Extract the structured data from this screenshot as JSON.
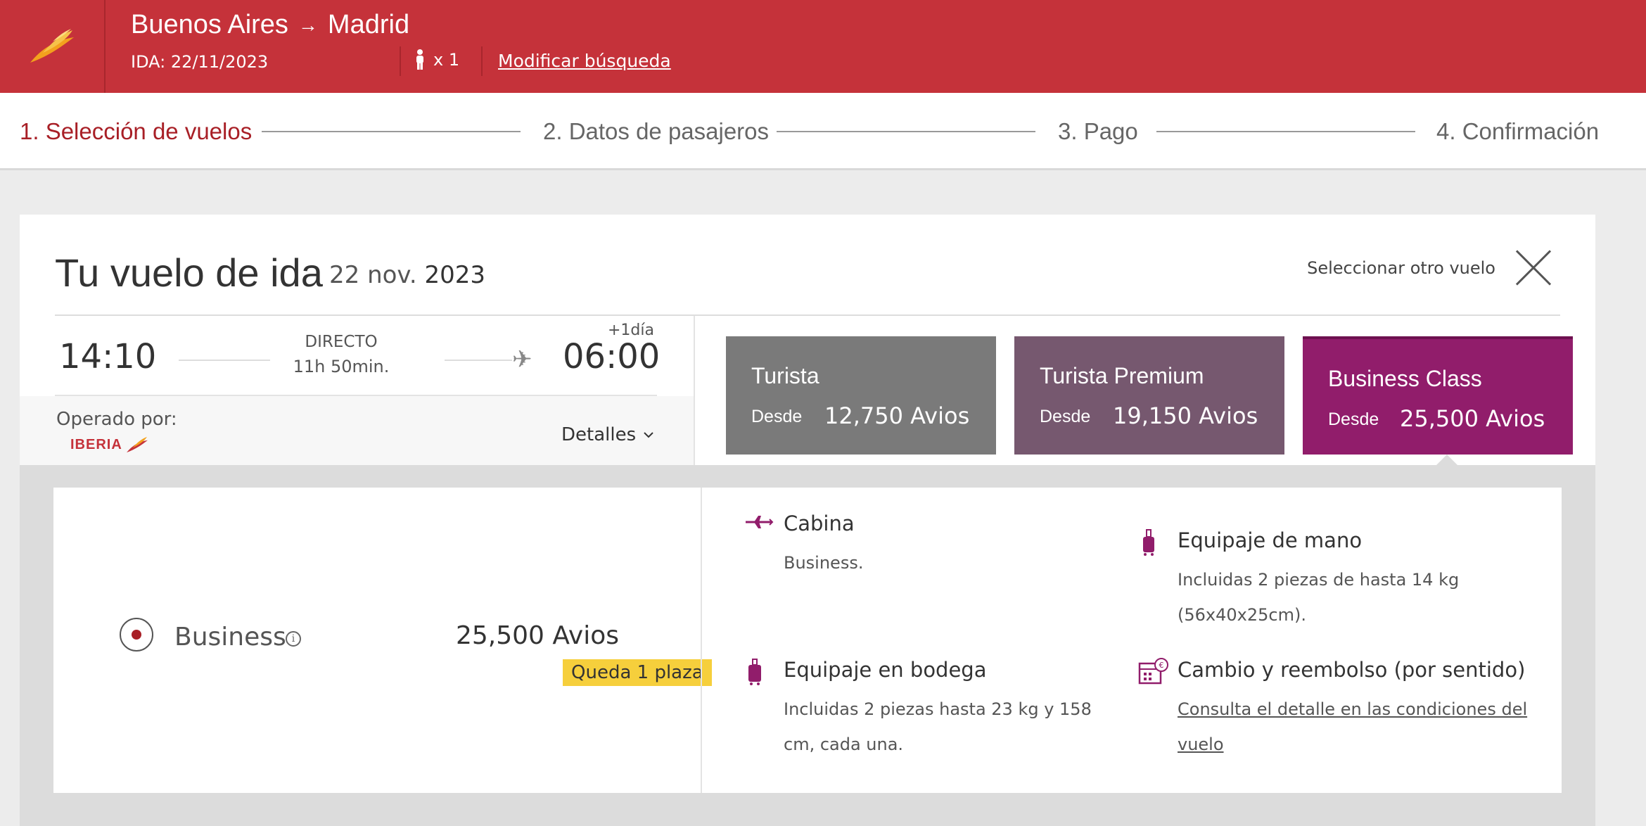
{
  "header": {
    "origin": "Buenos Aires",
    "arrow": "→",
    "destination": "Madrid",
    "ida": "IDA: 22/11/2023",
    "passengers": "x 1",
    "modify_label": "Modificar búsqueda"
  },
  "steps": [
    {
      "label": "1. Selección de vuelos",
      "active": true
    },
    {
      "label": "2. Datos de pasajeros",
      "active": false
    },
    {
      "label": "3. Pago",
      "active": false
    },
    {
      "label": "4. Confirmación",
      "active": false
    }
  ],
  "flight": {
    "title": "Tu vuelo de ida",
    "date_part1": "22 nov.",
    "date_part2": "2023",
    "select_other": "Seleccionar otro vuelo",
    "departure": "14:10",
    "type": "DIRECTO",
    "duration": "11h 50min.",
    "plus_day": "+1día",
    "arrival": "06:00",
    "operated_by": "Operado por:",
    "airline": "IBERIA",
    "details_label": "Detalles"
  },
  "fares": [
    {
      "name": "Turista",
      "desde": "Desde",
      "price": "12,750 Avios"
    },
    {
      "name": "Turista Premium",
      "desde": "Desde",
      "price": "19,150 Avios"
    },
    {
      "name": "Business Class",
      "desde": "Desde",
      "price": "25,500 Avios"
    }
  ],
  "selected": {
    "class_name": "Business",
    "info_icon": "i",
    "price": "25,500 Avios",
    "seats": "Queda 1 plaza"
  },
  "features": {
    "cabina": {
      "title": "Cabina",
      "desc": "Business."
    },
    "mano": {
      "title": "Equipaje de mano",
      "desc": "Incluidas 2 piezas de hasta 14 kg (56x40x25cm)."
    },
    "bodega": {
      "title": "Equipaje en bodega",
      "desc": "Incluidas 2 piezas hasta 23 kg y 158 cm, cada una."
    },
    "cambio": {
      "title": "Cambio y reembolso (por sentido)",
      "link": "Consulta el detalle en las condiciones del vuelo"
    }
  },
  "colors": {
    "brand_red": "#c5323a",
    "turista": "#7a7a7a",
    "premium": "#76586f",
    "business": "#911d6b",
    "badge": "#f6cf3c"
  },
  "icons": {
    "logo": "iberia-logo",
    "passenger": "person-icon",
    "close": "close-icon",
    "plane": "airplane-icon",
    "chevron": "chevron-down-icon",
    "info": "info-icon",
    "cabin": "cabin-plane-icon",
    "carry_on": "suitcase-icon",
    "checked": "luggage-icon",
    "refund": "calendar-euro-icon"
  }
}
